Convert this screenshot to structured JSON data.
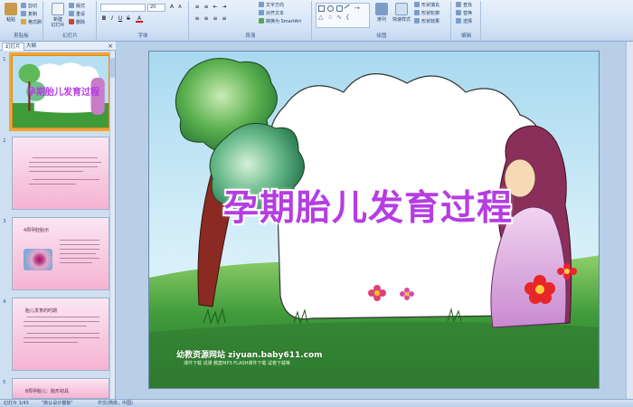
{
  "ribbon": {
    "clipboard": {
      "label": "剪贴板",
      "paste": "粘贴",
      "cut": "剪切",
      "copy": "复制",
      "format_painter": "格式刷"
    },
    "slides": {
      "label": "幻灯片",
      "new_slide": "新建\n幻灯片",
      "layout": "版式",
      "reset": "重设",
      "delete": "删除"
    },
    "font": {
      "label": "字体",
      "size": "20"
    },
    "paragraph": {
      "label": "段落",
      "text_direction": "文字方向",
      "align_text": "对齐文本",
      "smartart": "转换为 SmartArt"
    },
    "drawing": {
      "label": "绘图",
      "arrange": "排列",
      "quick_styles": "快速样式",
      "shape_fill": "形状填充",
      "shape_outline": "形状轮廓",
      "shape_effects": "形状效果"
    },
    "editing": {
      "label": "编辑",
      "find": "查找",
      "replace": "替换",
      "select": "选择"
    }
  },
  "left_pane": {
    "tab_slides": "幻灯片",
    "tab_outline": "大纲",
    "close": "×",
    "thumbs": [
      {
        "num": "1",
        "title": "孕期胎儿发育过程"
      },
      {
        "num": "2"
      },
      {
        "num": "3",
        "title": "4周孕胚胎示"
      },
      {
        "num": "4",
        "title": "胎儿发育的时期"
      },
      {
        "num": "5",
        "title": "8周孕胎儿：胎形初具"
      }
    ]
  },
  "slide": {
    "title": "孕期胎儿发育过程",
    "footer": "幼教资源网站 ziyuan.baby611.com",
    "footer_sub": "课件下载  说课  教案MP3  FLASH课件下载  试卷下载等"
  },
  "status": {
    "slide_pos": "幻灯片 1/43",
    "theme": "\"默认设计模板\"",
    "lang": "中文(简体，中国)"
  },
  "colors": {
    "title": "#b53de2",
    "title_glow": "#ffffff",
    "sky": "#b7dff2",
    "grass": "#3f9a3a"
  }
}
